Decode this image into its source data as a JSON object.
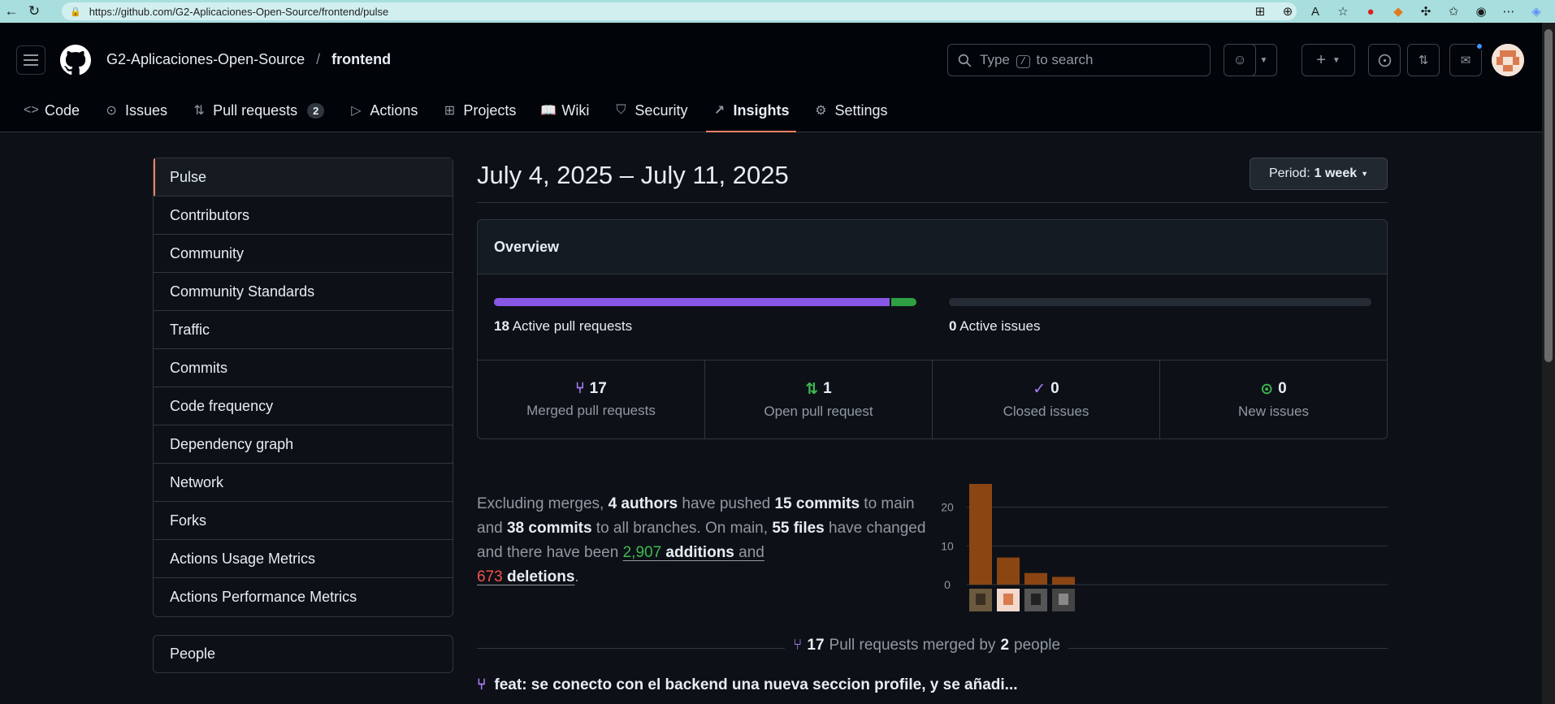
{
  "browser": {
    "url": "https://github.com/G2-Aplicaciones-Open-Source/frontend/pulse"
  },
  "header": {
    "org": "G2-Aplicaciones-Open-Source",
    "separator": "/",
    "repo": "frontend",
    "search_prefix": "Type",
    "search_key": "/",
    "search_suffix": "to search"
  },
  "tabs": [
    {
      "label": "Code",
      "icon": "code-icon"
    },
    {
      "label": "Issues",
      "icon": "issue-icon"
    },
    {
      "label": "Pull requests",
      "icon": "pull-request-icon",
      "count": "2"
    },
    {
      "label": "Actions",
      "icon": "play-icon"
    },
    {
      "label": "Projects",
      "icon": "table-icon"
    },
    {
      "label": "Wiki",
      "icon": "book-icon"
    },
    {
      "label": "Security",
      "icon": "shield-icon"
    },
    {
      "label": "Insights",
      "icon": "graph-icon",
      "active": true
    },
    {
      "label": "Settings",
      "icon": "gear-icon"
    }
  ],
  "sidebar": {
    "items": [
      {
        "label": "Pulse",
        "active": true
      },
      {
        "label": "Contributors"
      },
      {
        "label": "Community"
      },
      {
        "label": "Community Standards"
      },
      {
        "label": "Traffic"
      },
      {
        "label": "Commits"
      },
      {
        "label": "Code frequency"
      },
      {
        "label": "Dependency graph"
      },
      {
        "label": "Network"
      },
      {
        "label": "Forks"
      },
      {
        "label": "Actions Usage Metrics"
      },
      {
        "label": "Actions Performance Metrics"
      }
    ],
    "people": "People"
  },
  "main": {
    "period_title": "July 4, 2025 – July 11, 2025",
    "period_label": "Period:",
    "period_value": "1 week",
    "overview": {
      "title": "Overview",
      "active_prs_count": "18",
      "active_prs_label": "Active pull requests",
      "active_prs_merged_fraction": 0.94,
      "active_issues_count": "0",
      "active_issues_label": "Active issues",
      "stats": [
        {
          "value": "17",
          "label": "Merged pull requests",
          "icon": "merged-icon"
        },
        {
          "value": "1",
          "label": "Open pull request",
          "icon": "pull-request-icon"
        },
        {
          "value": "0",
          "label": "Closed issues",
          "icon": "closed-issue-icon"
        },
        {
          "value": "0",
          "label": "New issues",
          "icon": "issue-icon"
        }
      ]
    },
    "summary": {
      "p1": "Excluding merges, ",
      "authors": "4 authors",
      "p2": " have pushed ",
      "commits_main": "15 commits",
      "p3": " to main and ",
      "commits_all": "38 commits",
      "p4": " to all branches. On main, ",
      "files": "55 files",
      "p5": " have changed and there have been ",
      "additions_num": "2,907",
      "additions_word": "additions",
      "p6": " and ",
      "deletions_num": "673",
      "deletions_word": "deletions",
      "p7": "."
    },
    "pr_caption": {
      "count": "17",
      "text": "Pull requests merged by",
      "people_count": "2",
      "people_word": "people"
    },
    "pr_first": "feat: se conecto con el backend una nueva seccion profile, y se añadi..."
  },
  "chart_data": {
    "type": "bar",
    "categories": [
      "author-1",
      "author-2",
      "author-3",
      "author-4"
    ],
    "values": [
      26,
      7,
      3,
      2
    ],
    "ylim": [
      0,
      26
    ],
    "yticks": [
      "0",
      "10",
      "20"
    ],
    "bar_color": "#8b4513",
    "grid": true
  },
  "colors": {
    "accent_tab": "#f78166",
    "merged": "#ab7df8",
    "open": "#3fb950",
    "link_blue": "#4493f8"
  }
}
